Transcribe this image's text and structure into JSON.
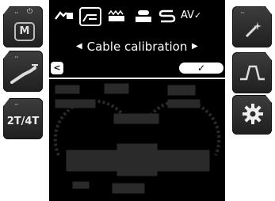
{
  "left_buttons": [
    {
      "dots": "···",
      "icon": "lock-icon",
      "glyph_top": "⏻",
      "glyph": "M"
    },
    {
      "dots": "···",
      "icon": "torch-icon",
      "glyph": ""
    },
    {
      "dots": "···",
      "icon": "trigger-icon",
      "glyph": "2T/4T"
    }
  ],
  "right_buttons": [
    {
      "dots": "···",
      "icon": "wand-icon",
      "glyph": ""
    },
    {
      "dots": "",
      "icon": "pulse-icon",
      "glyph": ""
    },
    {
      "dots": "",
      "icon": "gear-icon",
      "glyph": ""
    }
  ],
  "menu_icons": [
    {
      "icon": "cable-icon",
      "selected": false
    },
    {
      "icon": "cable-calibration-icon",
      "selected": true
    },
    {
      "icon": "roller-icon",
      "selected": false
    },
    {
      "icon": "spool-icon",
      "selected": false
    },
    {
      "icon": "s-curve-icon",
      "selected": false
    },
    {
      "icon": "av-check-icon",
      "selected": false,
      "text": "AV"
    }
  ],
  "selection": {
    "label": "Cable calibration",
    "left_arrow": "◀",
    "right_arrow": "▶"
  },
  "footer": {
    "back_label": "<",
    "confirm_label": "✓"
  },
  "colors": {
    "screen": "#000000",
    "foreground": "#ffffff",
    "ghost": "#2a2a2a",
    "button": "#2e2e2e"
  }
}
